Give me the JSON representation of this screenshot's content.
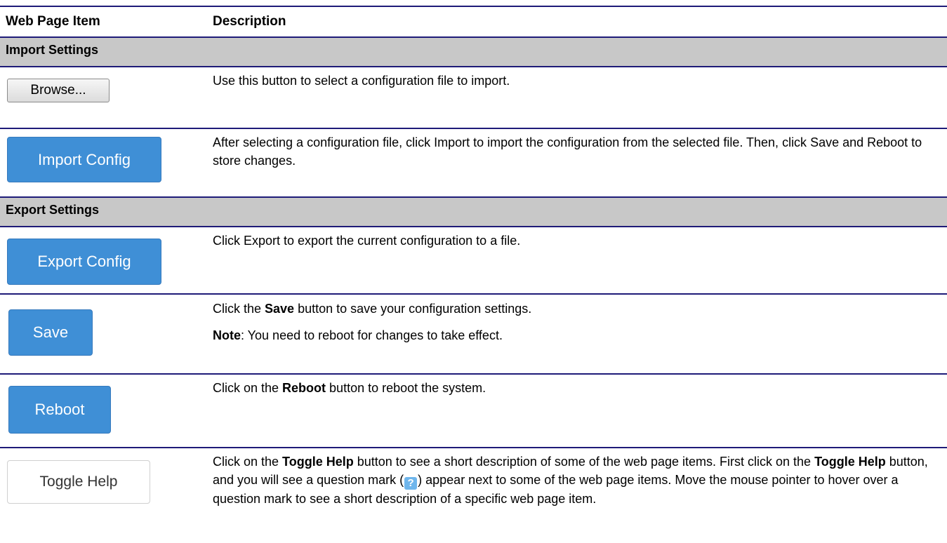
{
  "table": {
    "col1_header": "Web Page Item",
    "col2_header": "Description",
    "sections": {
      "import": "Import Settings",
      "export": "Export Settings"
    },
    "rows": {
      "browse": {
        "button": "Browse...",
        "desc": "Use this button to select a configuration file to import."
      },
      "import_config": {
        "button": "Import Config",
        "desc": "After selecting a configuration file, click Import to import the configuration from the selected file. Then, click Save and Reboot to store changes."
      },
      "export_config": {
        "button": "Export Config",
        "desc": "Click Export to export the current configuration to a file."
      },
      "save": {
        "button": "Save",
        "desc_pre": "Click the ",
        "desc_bold": "Save",
        "desc_post": " button to save your configuration settings.",
        "note_bold": "Note",
        "note_text": ": You need to reboot for changes to take effect."
      },
      "reboot": {
        "button": "Reboot",
        "desc_pre": "Click on the ",
        "desc_bold": "Reboot",
        "desc_post": " button to reboot the system."
      },
      "toggle_help": {
        "button": "Toggle Help",
        "desc_1": "Click on the ",
        "desc_bold_1": "Toggle Help",
        "desc_2": " button to see a short description of some of the web page items. First click on the ",
        "desc_bold_2": "Toggle Help",
        "desc_3": " button, and you will see a question mark (",
        "desc_4": ") appear next to some of the web page items. Move the mouse pointer to hover over a question mark to see a short description of a specific web page item."
      }
    }
  },
  "colors": {
    "rule": "#1e1b78",
    "section_bg": "#c8c8c8",
    "button_blue": "#3f8fd6"
  },
  "icons": {
    "question_mark": "question-mark-icon"
  }
}
